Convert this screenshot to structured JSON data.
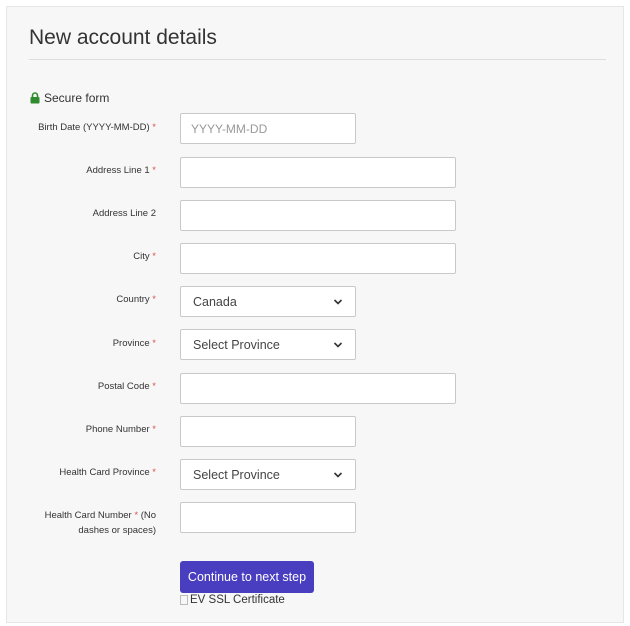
{
  "title": "New account details",
  "secure_text": "Secure form",
  "colors": {
    "accent": "#4a3ec0",
    "lock": "#2e8b2e",
    "required": "#d9534f"
  },
  "fields": {
    "birth_date": {
      "label": "Birth Date (YYYY-MM-DD)",
      "required": "*",
      "placeholder": "YYYY-MM-DD",
      "value": ""
    },
    "address1": {
      "label": "Address Line 1",
      "required": "*",
      "value": ""
    },
    "address2": {
      "label": "Address Line 2",
      "value": ""
    },
    "city": {
      "label": "City",
      "required": "*",
      "value": ""
    },
    "country": {
      "label": "Country",
      "required": "*",
      "selected": "Canada"
    },
    "province": {
      "label": "Province",
      "required": "*",
      "selected": "Select Province"
    },
    "postal": {
      "label": "Postal Code",
      "required": "*",
      "value": ""
    },
    "phone": {
      "label": "Phone Number",
      "required": "*",
      "value": ""
    },
    "health_province": {
      "label": "Health Card Province",
      "required": "*",
      "selected": "Select Province"
    },
    "health_number": {
      "label_a": "Health Card Number",
      "required": "*",
      "label_b": "(No",
      "label_c": "dashes or spaces)",
      "value": ""
    }
  },
  "continue_label": "Continue to next step",
  "cert_alt": "EV SSL Certificate"
}
